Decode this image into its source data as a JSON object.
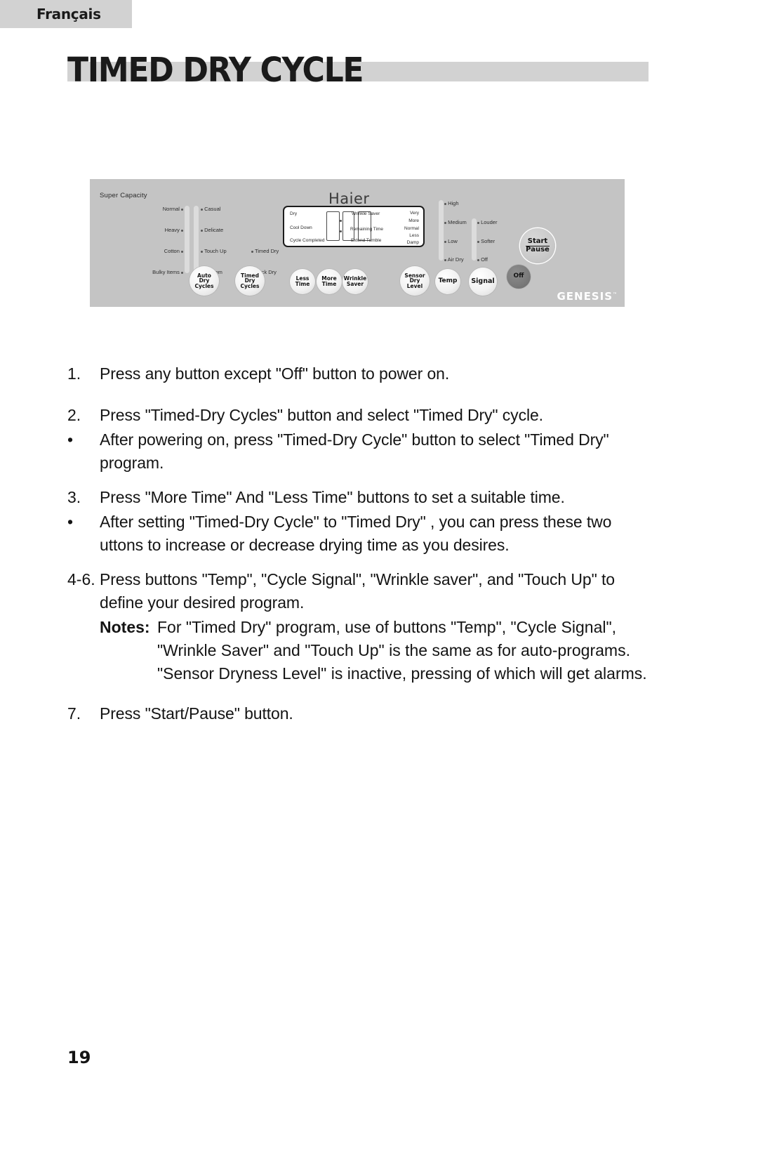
{
  "language_tab": {
    "label": "Français"
  },
  "page_title": "TIMED DRY CYCLE",
  "page_number": "19",
  "control_panel": {
    "capacity_label": "Super Capacity",
    "brand": "Haier",
    "sub_brand": "GENESIS",
    "sub_brand_mark": "™",
    "cycle_column_left": [
      "Normal",
      "Heavy",
      "Cotton",
      "Bulky Items"
    ],
    "cycle_column_right": [
      "Casual",
      "Delicate",
      "Touch Up",
      "Custom"
    ],
    "cycle_column_extra": [
      "Timed Dry",
      "Rack Dry"
    ],
    "display": {
      "left_labels": [
        "Dry",
        "Cool Down",
        "Cycle Completed"
      ],
      "center_labels": [
        "Wrinkle Saver",
        "Remaining Time",
        "Extend Tumble"
      ],
      "right_labels": [
        "Very",
        "More",
        "Normal",
        "Less",
        "Damp"
      ]
    },
    "temperature_options": [
      "High",
      "Medium",
      "Low",
      "Air Dry"
    ],
    "signal_options": [
      "Louder",
      "Softer",
      "Off"
    ],
    "buttons": [
      {
        "id": "auto-dry-cycles",
        "lines": [
          "Auto",
          "Dry",
          "Cycles"
        ]
      },
      {
        "id": "timed-dry-cycles",
        "lines": [
          "Timed",
          "Dry",
          "Cycles"
        ]
      },
      {
        "id": "less-time",
        "lines": [
          "Less",
          "Time"
        ]
      },
      {
        "id": "more-time",
        "lines": [
          "More",
          "Time"
        ]
      },
      {
        "id": "wrinkle-saver",
        "lines": [
          "Wrinkle",
          "Saver"
        ]
      },
      {
        "id": "sensor-dry-level",
        "lines": [
          "Sensor",
          "Dry",
          "Level"
        ]
      },
      {
        "id": "temp",
        "lines": [
          "Temp"
        ]
      },
      {
        "id": "signal",
        "lines": [
          "Signal"
        ]
      },
      {
        "id": "off",
        "lines": [
          "Off"
        ]
      },
      {
        "id": "start-pause",
        "lines": [
          "Start",
          "Pause"
        ]
      }
    ]
  },
  "instructions": {
    "step1_num": "1.",
    "step1_text": "Press any button except \"Off\" button to power on.",
    "step2_num": "2.",
    "step2_text": "Press \"Timed-Dry Cycles\" button and select \"Timed Dry\" cycle.",
    "step2_bullet": "•",
    "step2_bullet_text": "After powering on, press \"Timed-Dry Cycle\" button to select \"Timed Dry\" program.",
    "step3_num": "3.",
    "step3_text": "Press \"More Time\" And \"Less Time\" buttons to set a suitable time.",
    "step3_bullet": "•",
    "step3_bullet_text": "After setting \"Timed-Dry Cycle\" to \"Timed Dry\" , you can press these two uttons to increase or decrease drying time as you desires.",
    "step46_num": "4-6.",
    "step46_text": "Press buttons \"Temp\", \"Cycle Signal\", \"Wrinkle saver\", and \"Touch Up\" to define your desired program.",
    "notes_label": "Notes:",
    "notes_line1": "For \"Timed Dry\" program, use of buttons \"Temp\", \"Cycle Signal\",",
    "notes_line2": "\"Wrinkle Saver\" and \"Touch Up\" is the same as for auto-programs.",
    "notes_line3": "\"Sensor Dryness Level\" is inactive, pressing of which will get alarms.",
    "step7_num": "7.",
    "step7_text": "Press \"Start/Pause\" button."
  },
  "colors": {
    "accent_gray": "#d2d2d2",
    "panel_gray": "#c4c4c4",
    "text": "#141414"
  }
}
